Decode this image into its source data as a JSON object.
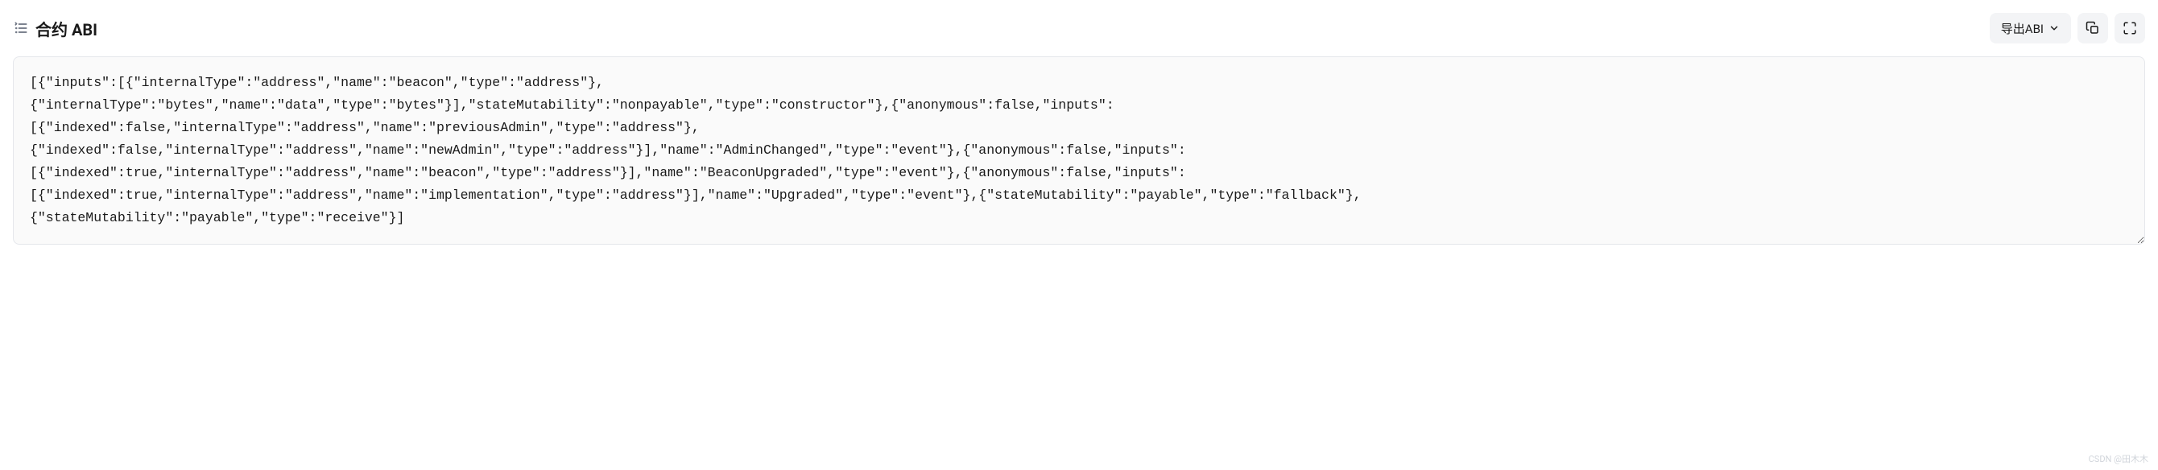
{
  "header": {
    "title": "合约 ABI",
    "export_label": "导出ABI"
  },
  "abi_content": "[{\"inputs\":[{\"internalType\":\"address\",\"name\":\"beacon\",\"type\":\"address\"},\n{\"internalType\":\"bytes\",\"name\":\"data\",\"type\":\"bytes\"}],\"stateMutability\":\"nonpayable\",\"type\":\"constructor\"},{\"anonymous\":false,\"inputs\":\n[{\"indexed\":false,\"internalType\":\"address\",\"name\":\"previousAdmin\",\"type\":\"address\"},\n{\"indexed\":false,\"internalType\":\"address\",\"name\":\"newAdmin\",\"type\":\"address\"}],\"name\":\"AdminChanged\",\"type\":\"event\"},{\"anonymous\":false,\"inputs\":\n[{\"indexed\":true,\"internalType\":\"address\",\"name\":\"beacon\",\"type\":\"address\"}],\"name\":\"BeaconUpgraded\",\"type\":\"event\"},{\"anonymous\":false,\"inputs\":\n[{\"indexed\":true,\"internalType\":\"address\",\"name\":\"implementation\",\"type\":\"address\"}],\"name\":\"Upgraded\",\"type\":\"event\"},{\"stateMutability\":\"payable\",\"type\":\"fallback\"},\n{\"stateMutability\":\"payable\",\"type\":\"receive\"}]",
  "watermark": "CSDN @田木木"
}
